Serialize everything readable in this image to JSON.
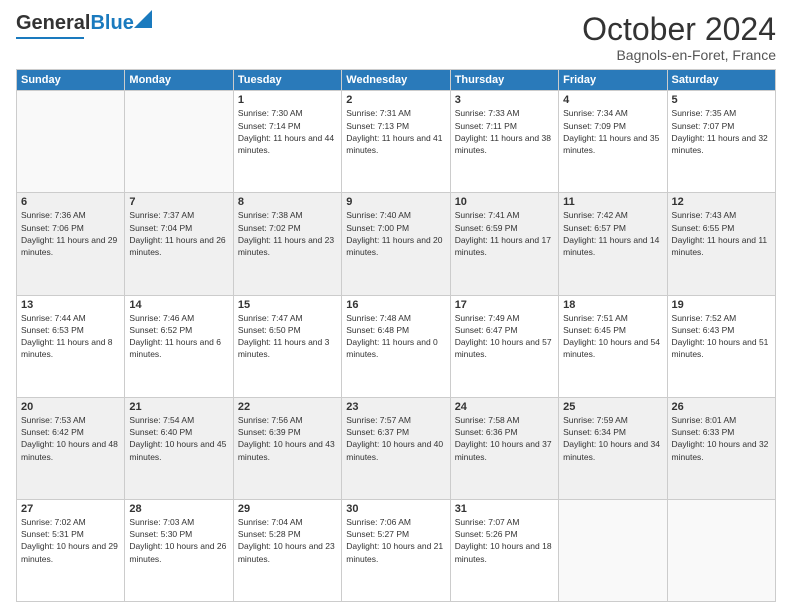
{
  "header": {
    "logo_general": "General",
    "logo_blue": "Blue",
    "month": "October 2024",
    "location": "Bagnols-en-Foret, France"
  },
  "weekdays": [
    "Sunday",
    "Monday",
    "Tuesday",
    "Wednesday",
    "Thursday",
    "Friday",
    "Saturday"
  ],
  "weeks": [
    [
      {
        "day": "",
        "sunrise": "",
        "sunset": "",
        "daylight": ""
      },
      {
        "day": "",
        "sunrise": "",
        "sunset": "",
        "daylight": ""
      },
      {
        "day": "1",
        "sunrise": "Sunrise: 7:30 AM",
        "sunset": "Sunset: 7:14 PM",
        "daylight": "Daylight: 11 hours and 44 minutes."
      },
      {
        "day": "2",
        "sunrise": "Sunrise: 7:31 AM",
        "sunset": "Sunset: 7:13 PM",
        "daylight": "Daylight: 11 hours and 41 minutes."
      },
      {
        "day": "3",
        "sunrise": "Sunrise: 7:33 AM",
        "sunset": "Sunset: 7:11 PM",
        "daylight": "Daylight: 11 hours and 38 minutes."
      },
      {
        "day": "4",
        "sunrise": "Sunrise: 7:34 AM",
        "sunset": "Sunset: 7:09 PM",
        "daylight": "Daylight: 11 hours and 35 minutes."
      },
      {
        "day": "5",
        "sunrise": "Sunrise: 7:35 AM",
        "sunset": "Sunset: 7:07 PM",
        "daylight": "Daylight: 11 hours and 32 minutes."
      }
    ],
    [
      {
        "day": "6",
        "sunrise": "Sunrise: 7:36 AM",
        "sunset": "Sunset: 7:06 PM",
        "daylight": "Daylight: 11 hours and 29 minutes."
      },
      {
        "day": "7",
        "sunrise": "Sunrise: 7:37 AM",
        "sunset": "Sunset: 7:04 PM",
        "daylight": "Daylight: 11 hours and 26 minutes."
      },
      {
        "day": "8",
        "sunrise": "Sunrise: 7:38 AM",
        "sunset": "Sunset: 7:02 PM",
        "daylight": "Daylight: 11 hours and 23 minutes."
      },
      {
        "day": "9",
        "sunrise": "Sunrise: 7:40 AM",
        "sunset": "Sunset: 7:00 PM",
        "daylight": "Daylight: 11 hours and 20 minutes."
      },
      {
        "day": "10",
        "sunrise": "Sunrise: 7:41 AM",
        "sunset": "Sunset: 6:59 PM",
        "daylight": "Daylight: 11 hours and 17 minutes."
      },
      {
        "day": "11",
        "sunrise": "Sunrise: 7:42 AM",
        "sunset": "Sunset: 6:57 PM",
        "daylight": "Daylight: 11 hours and 14 minutes."
      },
      {
        "day": "12",
        "sunrise": "Sunrise: 7:43 AM",
        "sunset": "Sunset: 6:55 PM",
        "daylight": "Daylight: 11 hours and 11 minutes."
      }
    ],
    [
      {
        "day": "13",
        "sunrise": "Sunrise: 7:44 AM",
        "sunset": "Sunset: 6:53 PM",
        "daylight": "Daylight: 11 hours and 8 minutes."
      },
      {
        "day": "14",
        "sunrise": "Sunrise: 7:46 AM",
        "sunset": "Sunset: 6:52 PM",
        "daylight": "Daylight: 11 hours and 6 minutes."
      },
      {
        "day": "15",
        "sunrise": "Sunrise: 7:47 AM",
        "sunset": "Sunset: 6:50 PM",
        "daylight": "Daylight: 11 hours and 3 minutes."
      },
      {
        "day": "16",
        "sunrise": "Sunrise: 7:48 AM",
        "sunset": "Sunset: 6:48 PM",
        "daylight": "Daylight: 11 hours and 0 minutes."
      },
      {
        "day": "17",
        "sunrise": "Sunrise: 7:49 AM",
        "sunset": "Sunset: 6:47 PM",
        "daylight": "Daylight: 10 hours and 57 minutes."
      },
      {
        "day": "18",
        "sunrise": "Sunrise: 7:51 AM",
        "sunset": "Sunset: 6:45 PM",
        "daylight": "Daylight: 10 hours and 54 minutes."
      },
      {
        "day": "19",
        "sunrise": "Sunrise: 7:52 AM",
        "sunset": "Sunset: 6:43 PM",
        "daylight": "Daylight: 10 hours and 51 minutes."
      }
    ],
    [
      {
        "day": "20",
        "sunrise": "Sunrise: 7:53 AM",
        "sunset": "Sunset: 6:42 PM",
        "daylight": "Daylight: 10 hours and 48 minutes."
      },
      {
        "day": "21",
        "sunrise": "Sunrise: 7:54 AM",
        "sunset": "Sunset: 6:40 PM",
        "daylight": "Daylight: 10 hours and 45 minutes."
      },
      {
        "day": "22",
        "sunrise": "Sunrise: 7:56 AM",
        "sunset": "Sunset: 6:39 PM",
        "daylight": "Daylight: 10 hours and 43 minutes."
      },
      {
        "day": "23",
        "sunrise": "Sunrise: 7:57 AM",
        "sunset": "Sunset: 6:37 PM",
        "daylight": "Daylight: 10 hours and 40 minutes."
      },
      {
        "day": "24",
        "sunrise": "Sunrise: 7:58 AM",
        "sunset": "Sunset: 6:36 PM",
        "daylight": "Daylight: 10 hours and 37 minutes."
      },
      {
        "day": "25",
        "sunrise": "Sunrise: 7:59 AM",
        "sunset": "Sunset: 6:34 PM",
        "daylight": "Daylight: 10 hours and 34 minutes."
      },
      {
        "day": "26",
        "sunrise": "Sunrise: 8:01 AM",
        "sunset": "Sunset: 6:33 PM",
        "daylight": "Daylight: 10 hours and 32 minutes."
      }
    ],
    [
      {
        "day": "27",
        "sunrise": "Sunrise: 7:02 AM",
        "sunset": "Sunset: 5:31 PM",
        "daylight": "Daylight: 10 hours and 29 minutes."
      },
      {
        "day": "28",
        "sunrise": "Sunrise: 7:03 AM",
        "sunset": "Sunset: 5:30 PM",
        "daylight": "Daylight: 10 hours and 26 minutes."
      },
      {
        "day": "29",
        "sunrise": "Sunrise: 7:04 AM",
        "sunset": "Sunset: 5:28 PM",
        "daylight": "Daylight: 10 hours and 23 minutes."
      },
      {
        "day": "30",
        "sunrise": "Sunrise: 7:06 AM",
        "sunset": "Sunset: 5:27 PM",
        "daylight": "Daylight: 10 hours and 21 minutes."
      },
      {
        "day": "31",
        "sunrise": "Sunrise: 7:07 AM",
        "sunset": "Sunset: 5:26 PM",
        "daylight": "Daylight: 10 hours and 18 minutes."
      },
      {
        "day": "",
        "sunrise": "",
        "sunset": "",
        "daylight": ""
      },
      {
        "day": "",
        "sunrise": "",
        "sunset": "",
        "daylight": ""
      }
    ]
  ]
}
